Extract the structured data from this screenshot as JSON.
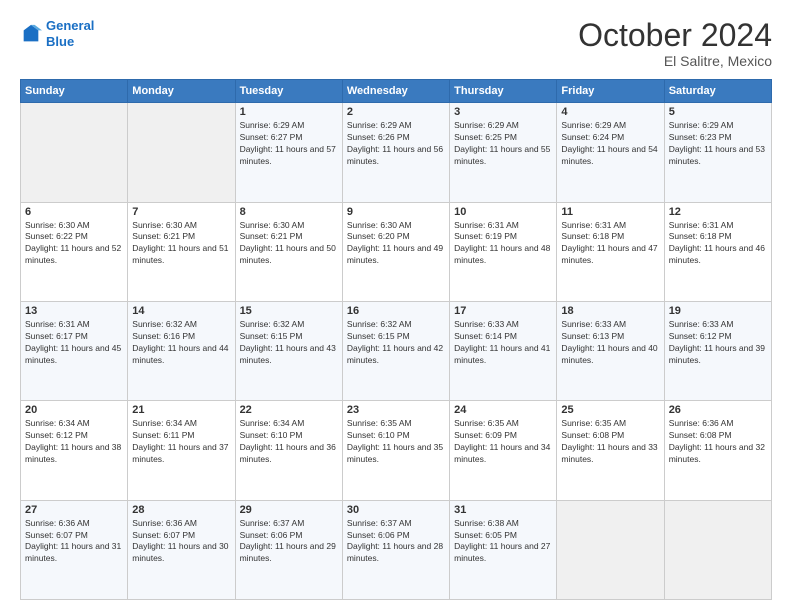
{
  "header": {
    "logo_line1": "General",
    "logo_line2": "Blue",
    "month": "October 2024",
    "location": "El Salitre, Mexico"
  },
  "days_of_week": [
    "Sunday",
    "Monday",
    "Tuesday",
    "Wednesday",
    "Thursday",
    "Friday",
    "Saturday"
  ],
  "weeks": [
    [
      {
        "day": "",
        "info": ""
      },
      {
        "day": "",
        "info": ""
      },
      {
        "day": "1",
        "info": "Sunrise: 6:29 AM\nSunset: 6:27 PM\nDaylight: 11 hours and 57 minutes."
      },
      {
        "day": "2",
        "info": "Sunrise: 6:29 AM\nSunset: 6:26 PM\nDaylight: 11 hours and 56 minutes."
      },
      {
        "day": "3",
        "info": "Sunrise: 6:29 AM\nSunset: 6:25 PM\nDaylight: 11 hours and 55 minutes."
      },
      {
        "day": "4",
        "info": "Sunrise: 6:29 AM\nSunset: 6:24 PM\nDaylight: 11 hours and 54 minutes."
      },
      {
        "day": "5",
        "info": "Sunrise: 6:29 AM\nSunset: 6:23 PM\nDaylight: 11 hours and 53 minutes."
      }
    ],
    [
      {
        "day": "6",
        "info": "Sunrise: 6:30 AM\nSunset: 6:22 PM\nDaylight: 11 hours and 52 minutes."
      },
      {
        "day": "7",
        "info": "Sunrise: 6:30 AM\nSunset: 6:21 PM\nDaylight: 11 hours and 51 minutes."
      },
      {
        "day": "8",
        "info": "Sunrise: 6:30 AM\nSunset: 6:21 PM\nDaylight: 11 hours and 50 minutes."
      },
      {
        "day": "9",
        "info": "Sunrise: 6:30 AM\nSunset: 6:20 PM\nDaylight: 11 hours and 49 minutes."
      },
      {
        "day": "10",
        "info": "Sunrise: 6:31 AM\nSunset: 6:19 PM\nDaylight: 11 hours and 48 minutes."
      },
      {
        "day": "11",
        "info": "Sunrise: 6:31 AM\nSunset: 6:18 PM\nDaylight: 11 hours and 47 minutes."
      },
      {
        "day": "12",
        "info": "Sunrise: 6:31 AM\nSunset: 6:18 PM\nDaylight: 11 hours and 46 minutes."
      }
    ],
    [
      {
        "day": "13",
        "info": "Sunrise: 6:31 AM\nSunset: 6:17 PM\nDaylight: 11 hours and 45 minutes."
      },
      {
        "day": "14",
        "info": "Sunrise: 6:32 AM\nSunset: 6:16 PM\nDaylight: 11 hours and 44 minutes."
      },
      {
        "day": "15",
        "info": "Sunrise: 6:32 AM\nSunset: 6:15 PM\nDaylight: 11 hours and 43 minutes."
      },
      {
        "day": "16",
        "info": "Sunrise: 6:32 AM\nSunset: 6:15 PM\nDaylight: 11 hours and 42 minutes."
      },
      {
        "day": "17",
        "info": "Sunrise: 6:33 AM\nSunset: 6:14 PM\nDaylight: 11 hours and 41 minutes."
      },
      {
        "day": "18",
        "info": "Sunrise: 6:33 AM\nSunset: 6:13 PM\nDaylight: 11 hours and 40 minutes."
      },
      {
        "day": "19",
        "info": "Sunrise: 6:33 AM\nSunset: 6:12 PM\nDaylight: 11 hours and 39 minutes."
      }
    ],
    [
      {
        "day": "20",
        "info": "Sunrise: 6:34 AM\nSunset: 6:12 PM\nDaylight: 11 hours and 38 minutes."
      },
      {
        "day": "21",
        "info": "Sunrise: 6:34 AM\nSunset: 6:11 PM\nDaylight: 11 hours and 37 minutes."
      },
      {
        "day": "22",
        "info": "Sunrise: 6:34 AM\nSunset: 6:10 PM\nDaylight: 11 hours and 36 minutes."
      },
      {
        "day": "23",
        "info": "Sunrise: 6:35 AM\nSunset: 6:10 PM\nDaylight: 11 hours and 35 minutes."
      },
      {
        "day": "24",
        "info": "Sunrise: 6:35 AM\nSunset: 6:09 PM\nDaylight: 11 hours and 34 minutes."
      },
      {
        "day": "25",
        "info": "Sunrise: 6:35 AM\nSunset: 6:08 PM\nDaylight: 11 hours and 33 minutes."
      },
      {
        "day": "26",
        "info": "Sunrise: 6:36 AM\nSunset: 6:08 PM\nDaylight: 11 hours and 32 minutes."
      }
    ],
    [
      {
        "day": "27",
        "info": "Sunrise: 6:36 AM\nSunset: 6:07 PM\nDaylight: 11 hours and 31 minutes."
      },
      {
        "day": "28",
        "info": "Sunrise: 6:36 AM\nSunset: 6:07 PM\nDaylight: 11 hours and 30 minutes."
      },
      {
        "day": "29",
        "info": "Sunrise: 6:37 AM\nSunset: 6:06 PM\nDaylight: 11 hours and 29 minutes."
      },
      {
        "day": "30",
        "info": "Sunrise: 6:37 AM\nSunset: 6:06 PM\nDaylight: 11 hours and 28 minutes."
      },
      {
        "day": "31",
        "info": "Sunrise: 6:38 AM\nSunset: 6:05 PM\nDaylight: 11 hours and 27 minutes."
      },
      {
        "day": "",
        "info": ""
      },
      {
        "day": "",
        "info": ""
      }
    ]
  ]
}
